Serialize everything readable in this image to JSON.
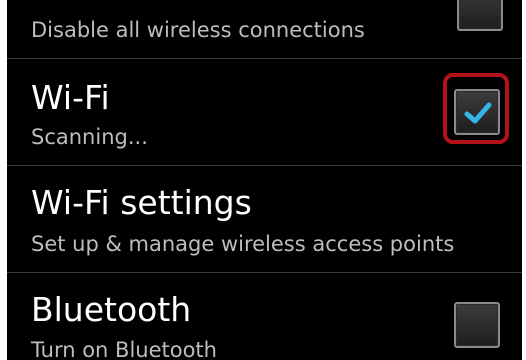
{
  "settings": {
    "airplane": {
      "summary": "Disable all wireless connections",
      "checked": false
    },
    "wifi": {
      "title": "Wi-Fi",
      "summary": "Scanning...",
      "checked": true
    },
    "wifi_settings": {
      "title": "Wi-Fi settings",
      "summary": "Set up & manage wireless access points"
    },
    "bluetooth": {
      "title": "Bluetooth",
      "summary": "Turn on Bluetooth",
      "checked": false
    }
  },
  "colors": {
    "background": "#000000",
    "check_mark": "#33b5e5",
    "highlight": "#b3131b"
  },
  "icons": {
    "check": "checkmark-icon"
  }
}
